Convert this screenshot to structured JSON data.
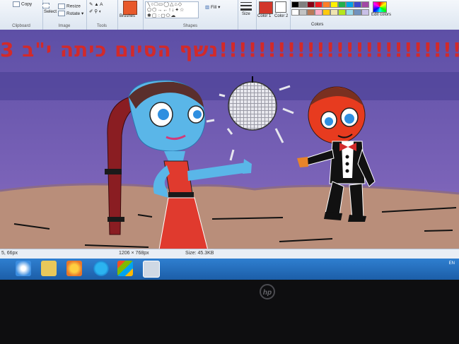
{
  "ribbon": {
    "clipboard": {
      "copy": "Copy",
      "label": "Clipboard"
    },
    "image": {
      "select": "Select",
      "resize": "Resize",
      "rotate": "Rotate",
      "label": "Image"
    },
    "tools": {
      "label": "Tools"
    },
    "brushes": {
      "label": "Brushes"
    },
    "shapes": {
      "fill": "Fill",
      "label": "Shapes"
    },
    "size": {
      "label": "Size"
    },
    "color1": {
      "label": "Color 1",
      "value": "#d2372a"
    },
    "color2": {
      "label": "Color 2",
      "value": "#ffffff"
    },
    "colors": {
      "label": "Colors"
    },
    "edit_colors": "Edit colors"
  },
  "palette": [
    "#000000",
    "#7f7f7f",
    "#880015",
    "#ed1c24",
    "#ff7f27",
    "#fff200",
    "#22b14c",
    "#00a2e8",
    "#3f48cc",
    "#a349a4",
    "#ffffff",
    "#c3c3c3",
    "#b97a57",
    "#ffaec9",
    "#ffc90e",
    "#efe4b0",
    "#b5e61d",
    "#99d9ea",
    "#7092be",
    "#c8bfe7"
  ],
  "canvas": {
    "title": "נשף הסיום כיתה י\"ב 3!!!!!!!!!!!!!!!!!!!!!!!!!!"
  },
  "status": {
    "position": "5, 66px",
    "dimensions": "1206 × 768px",
    "size": "Size: 45.3KB"
  },
  "taskbar": {
    "tray_text": "EN"
  },
  "laptop": {
    "logo": "hp"
  }
}
